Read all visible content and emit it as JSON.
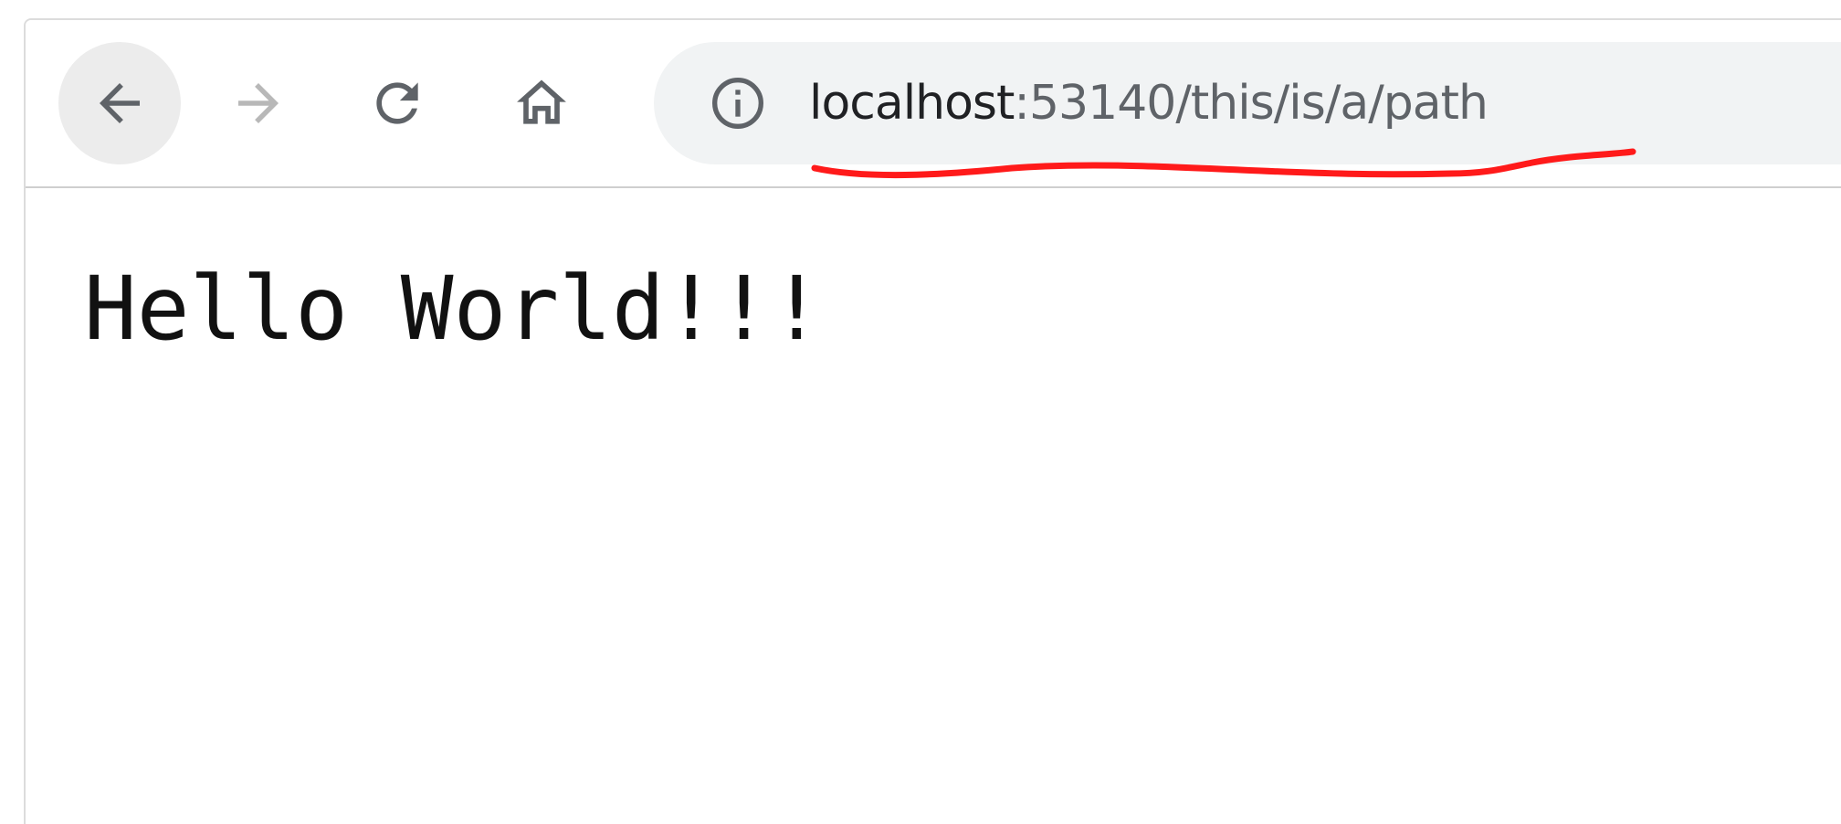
{
  "toolbar": {
    "back_icon": "arrow-left-icon",
    "forward_icon": "arrow-right-icon",
    "reload_icon": "reload-icon",
    "home_icon": "home-icon"
  },
  "address_bar": {
    "info_icon": "info-icon",
    "host": "localhost",
    "rest": ":53140/this/is/a/path"
  },
  "page": {
    "body_text": "Hello World!!!"
  },
  "colors": {
    "annotation_stroke": "#ff1a1a",
    "host_text": "#202124",
    "path_text": "#5f6368",
    "omnibox_bg": "#f1f3f4"
  }
}
